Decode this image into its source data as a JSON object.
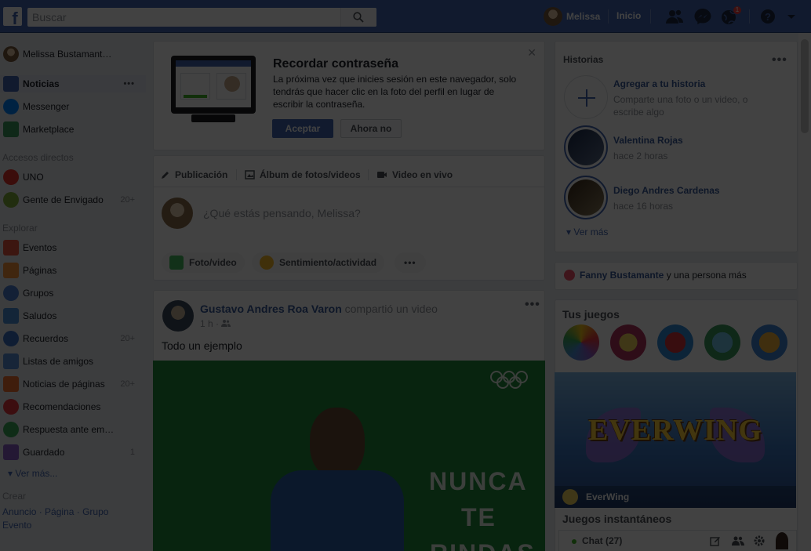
{
  "topbar": {
    "logo": "f",
    "search_placeholder": "Buscar",
    "user_name": "Melissa",
    "home_label": "Inicio",
    "notification_count": "1"
  },
  "left": {
    "profile": "Melissa Bustamant…",
    "main_items": [
      {
        "label": "Noticias",
        "icon": "news-feed-icon"
      },
      {
        "label": "Messenger",
        "icon": "messenger-icon"
      },
      {
        "label": "Marketplace",
        "icon": "marketplace-icon"
      }
    ],
    "shortcuts_title": "Accesos directos",
    "shortcuts": [
      {
        "label": "UNO",
        "icon": "uno-game-icon",
        "count": ""
      },
      {
        "label": "Gente de Envigado",
        "icon": "group-tree-icon",
        "count": "20+"
      }
    ],
    "explore_title": "Explorar",
    "explore": [
      {
        "label": "Eventos",
        "icon": "calendar-icon",
        "count": ""
      },
      {
        "label": "Páginas",
        "icon": "flag-icon",
        "count": ""
      },
      {
        "label": "Grupos",
        "icon": "groups-icon",
        "count": ""
      },
      {
        "label": "Saludos",
        "icon": "wave-icon",
        "count": ""
      },
      {
        "label": "Recuerdos",
        "icon": "memories-icon",
        "count": "20+"
      },
      {
        "label": "Listas de amigos",
        "icon": "friends-list-icon",
        "count": ""
      },
      {
        "label": "Noticias de páginas",
        "icon": "pages-feed-icon",
        "count": "20+"
      },
      {
        "label": "Recomendaciones",
        "icon": "recommendations-icon",
        "count": ""
      },
      {
        "label": "Respuesta ante em…",
        "icon": "crisis-response-icon",
        "count": ""
      },
      {
        "label": "Guardado",
        "icon": "saved-icon",
        "count": "1"
      }
    ],
    "see_more": "Ver más...",
    "create_title": "Crear",
    "create_links": [
      "Anuncio",
      "Página",
      "Grupo",
      "Evento"
    ]
  },
  "password_card": {
    "title": "Recordar contraseña",
    "text": "La próxima vez que inicies sesión en este navegador, solo tendrás que hacer clic en la foto del perfil en lugar de escribir la contraseña.",
    "accept": "Aceptar",
    "decline": "Ahora no"
  },
  "composer": {
    "tabs": [
      "Publicación",
      "Álbum de fotos/videos",
      "Video en vivo"
    ],
    "placeholder": "¿Qué estás pensando, Melissa?",
    "actions": [
      "Foto/video",
      "Sentimiento/actividad"
    ]
  },
  "post": {
    "author": "Gustavo Andres Roa Varon",
    "action": "compartió un video",
    "time": "1 h",
    "text": "Todo un ejemplo",
    "video_text_1": "NUNCA",
    "video_text_2": "TE",
    "video_text_3": "RINDAS"
  },
  "stories": {
    "title": "Historias",
    "add_title": "Agregar a tu historia",
    "add_sub": "Comparte una foto o un video, o escribe algo",
    "items": [
      {
        "name": "Valentina Rojas",
        "time": "hace 2 horas"
      },
      {
        "name": "Diego Andres Cardenas",
        "time": "hace 16 horas"
      }
    ],
    "see_more": "Ver más"
  },
  "birthday": {
    "name": "Fanny Bustamante",
    "rest": " y una persona más"
  },
  "games": {
    "title": "Tus juegos",
    "banner_title": "EVERWING",
    "banner_label": "EverWing",
    "instant": "Juegos instantáneos"
  },
  "chat": {
    "label": "Chat (27)"
  }
}
